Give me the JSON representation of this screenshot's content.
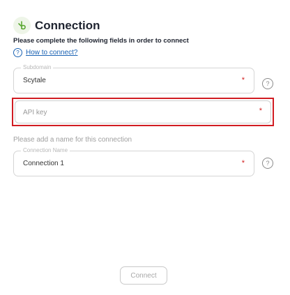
{
  "header": {
    "title": "Connection",
    "logo_icon": "b-logo-icon",
    "logo_color": "#5aa832"
  },
  "instructions": "Please complete the following fields in order to connect",
  "howto": {
    "icon": "question-icon",
    "label": "How to connect?"
  },
  "subdomain": {
    "legend": "Subdomain",
    "value": "Scytale",
    "required_mark": "*"
  },
  "api_key": {
    "placeholder": "API key",
    "value": "",
    "required_mark": "*",
    "highlight_color": "#d11c22"
  },
  "name_prompt": "Please add a name for this connection",
  "connection_name": {
    "legend": "Connection Name",
    "value": "Connection 1",
    "required_mark": "*"
  },
  "help_icon": "?",
  "connect_button": {
    "label": "Connect"
  }
}
